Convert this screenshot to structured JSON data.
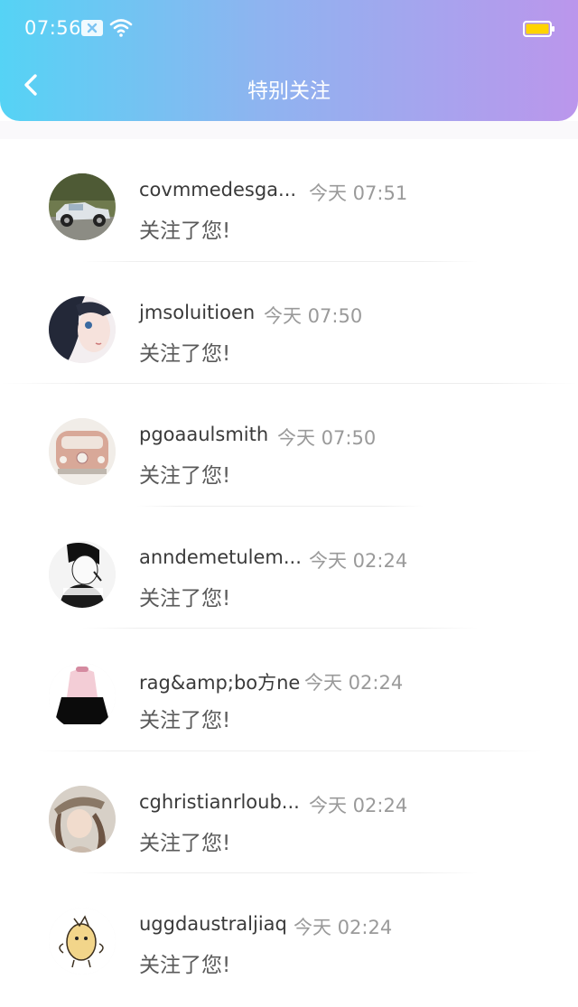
{
  "status_bar": {
    "time": "07:56",
    "icons": [
      "sim-icon",
      "wifi-icon",
      "battery-icon"
    ],
    "battery_color": "#ffd400"
  },
  "header": {
    "title": "特别关注",
    "back_icon": "chevron-left-icon",
    "gradient": [
      "#55d3f5",
      "#bb96ec"
    ]
  },
  "notifications": [
    {
      "username": "covmmedesga...",
      "time": "今天 07:51",
      "message": "关注了您!",
      "avatar": "vintage-car-avatar"
    },
    {
      "username": "jmsoluitioen",
      "time": "今天 07:50",
      "message": "关注了您!",
      "avatar": "anime-girl-avatar"
    },
    {
      "username": "pgoaaulsmith",
      "time": "今天 07:50",
      "message": "关注了您!",
      "avatar": "vw-bus-avatar"
    },
    {
      "username": "anndemetulem...",
      "time": "今天 02:24",
      "message": "关注了您!",
      "avatar": "boy-portrait-avatar"
    },
    {
      "username": "rag&amp;bo方ne",
      "time": "今天 02:24",
      "message": "关注了您!",
      "avatar": "girl-skirt-avatar"
    },
    {
      "username": "cghristianrloub...",
      "time": "今天 02:24",
      "message": "关注了您!",
      "avatar": "girl-hat-avatar"
    },
    {
      "username": "uggdaustraljiaq",
      "time": "今天 02:24",
      "message": "关注了您!",
      "avatar": "cartoon-chick-avatar"
    }
  ]
}
